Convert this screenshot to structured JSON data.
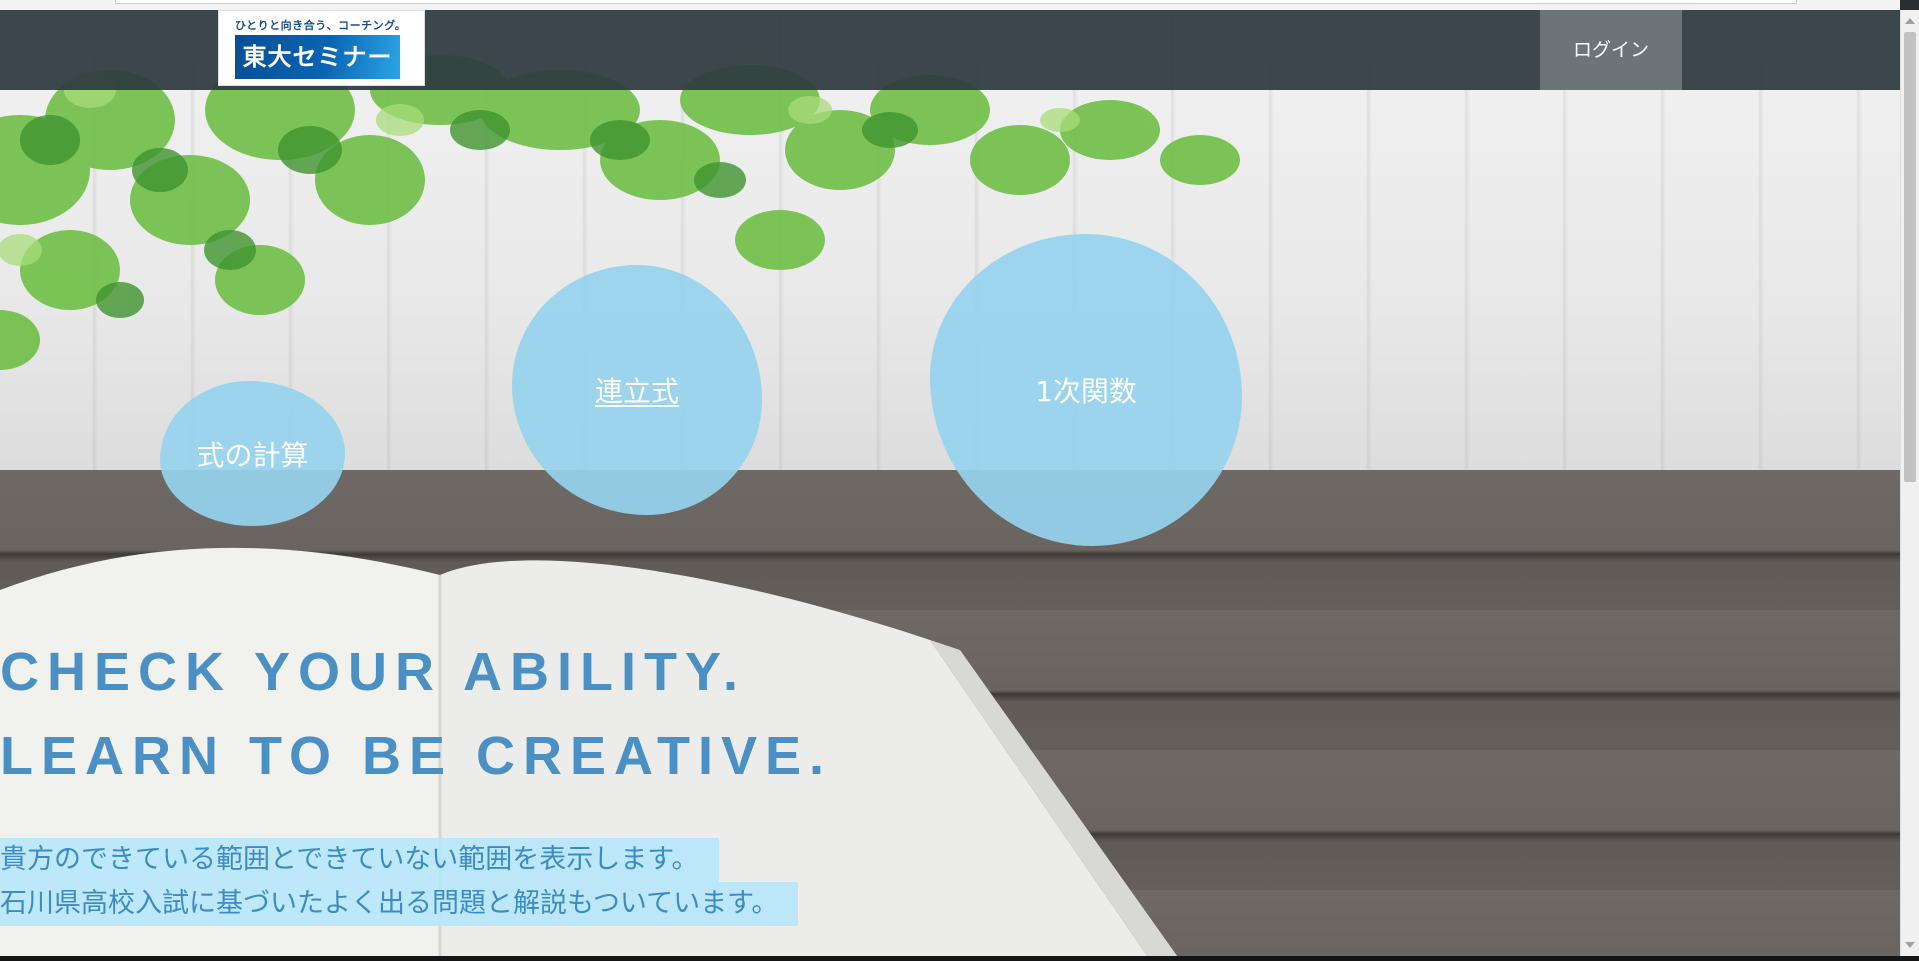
{
  "logo": {
    "tagline": "ひとりと向き合う、コーチング。",
    "name": "東大セミナー"
  },
  "nav": {
    "login_label": "ログイン"
  },
  "topics": [
    {
      "label": "式の計算"
    },
    {
      "label": "連立式"
    },
    {
      "label": "1次関数"
    }
  ],
  "hero": {
    "headline_line1": "CHECK YOUR ABILITY.",
    "headline_line2": "LEARN TO BE CREATIVE.",
    "desc_line1": "貴方のできている範囲とできていない範囲を表示します。",
    "desc_line2": "石川県高校入試に基づいたよく出る問題と解説もついています。"
  },
  "colors": {
    "accent": "#4a90c4",
    "bubble": "#95d2ed",
    "navbar": "#2e3a3e"
  }
}
